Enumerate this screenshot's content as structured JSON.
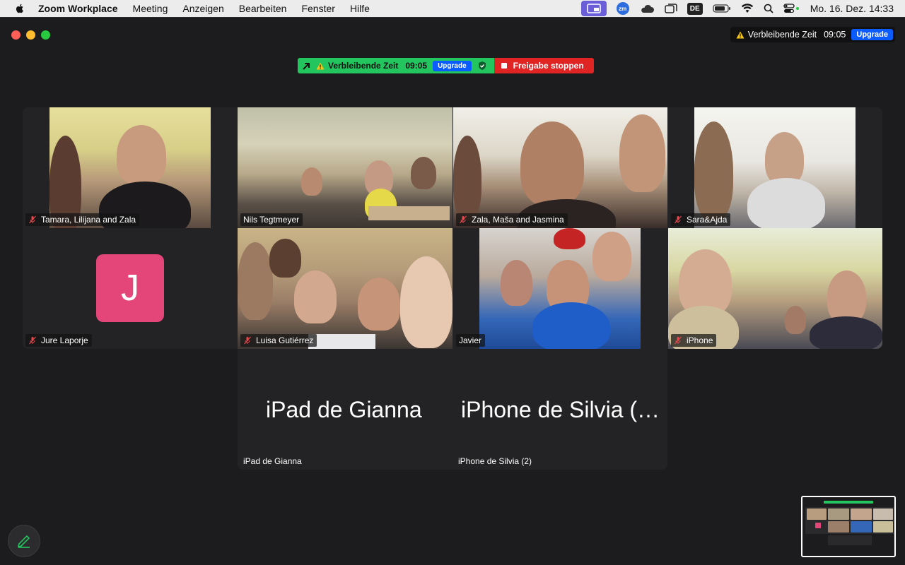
{
  "menubar": {
    "app_name": "Zoom Workplace",
    "items": [
      "Meeting",
      "Anzeigen",
      "Bearbeiten",
      "Fenster",
      "Hilfe"
    ],
    "input_language": "DE",
    "zoom_badge": "zm",
    "clock": "Mo. 16. Dez.  14:33"
  },
  "timer": {
    "label": "Verbleibende Zeit",
    "time": "09:05",
    "upgrade": "Upgrade"
  },
  "share_bar": {
    "label": "Verbleibende Zeit",
    "time": "09:05",
    "upgrade": "Upgrade",
    "stop": "Freigabe stoppen"
  },
  "participants": {
    "tamara": "Tamara, Lilijana and Zala",
    "nils": "Nils Tegtmeyer",
    "zala": "Zala, Maša and Jasmina",
    "sara": "Sara&Ajda",
    "jure": "Jure Laporje",
    "jure_initial": "J",
    "luisa": "Luisa Gutiérrez",
    "javier": "Javier",
    "iphone": "iPhone",
    "gianna_big": "iPad de Gianna",
    "gianna": "iPad de Gianna",
    "silvia_big": "iPhone de Silvia (…",
    "silvia": "iPhone de Silvia (2)"
  },
  "colors": {
    "accent_green": "#22c55e",
    "stop_red": "#e02424",
    "upgrade_blue": "#0b5cff",
    "avatar_pink": "#e5467a"
  }
}
